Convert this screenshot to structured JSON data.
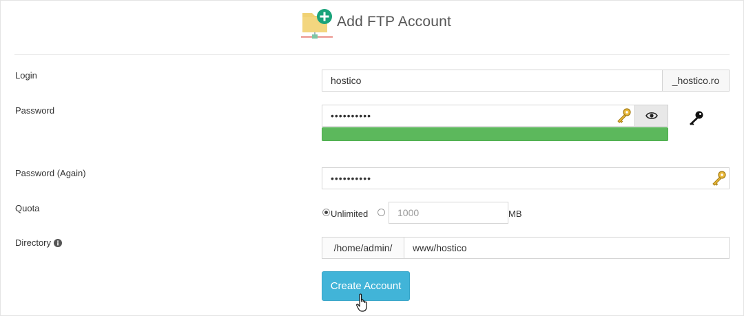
{
  "header": {
    "title": "Add FTP Account",
    "icon": "folder-add-icon"
  },
  "form": {
    "login": {
      "label": "Login",
      "value": "hostico",
      "suffix": "_hostico.ro"
    },
    "password": {
      "label": "Password",
      "value": "••••••••••",
      "strength_percent": 100
    },
    "password_again": {
      "label": "Password (Again)",
      "value": "••••••••••"
    },
    "quota": {
      "label": "Quota",
      "unlimited_label": "Unlimited",
      "limit_placeholder": "1000",
      "unit": "MB",
      "selected": "Unlimited"
    },
    "directory": {
      "label": "Directory",
      "prefix": "/home/admin/",
      "value": "www/hostico"
    }
  },
  "actions": {
    "create_label": "Create Account"
  },
  "colors": {
    "strength_bar": "#5cb85c",
    "button": "#41b4d8",
    "folder": "#f0d173",
    "plus_badge": "#1aa37a"
  }
}
